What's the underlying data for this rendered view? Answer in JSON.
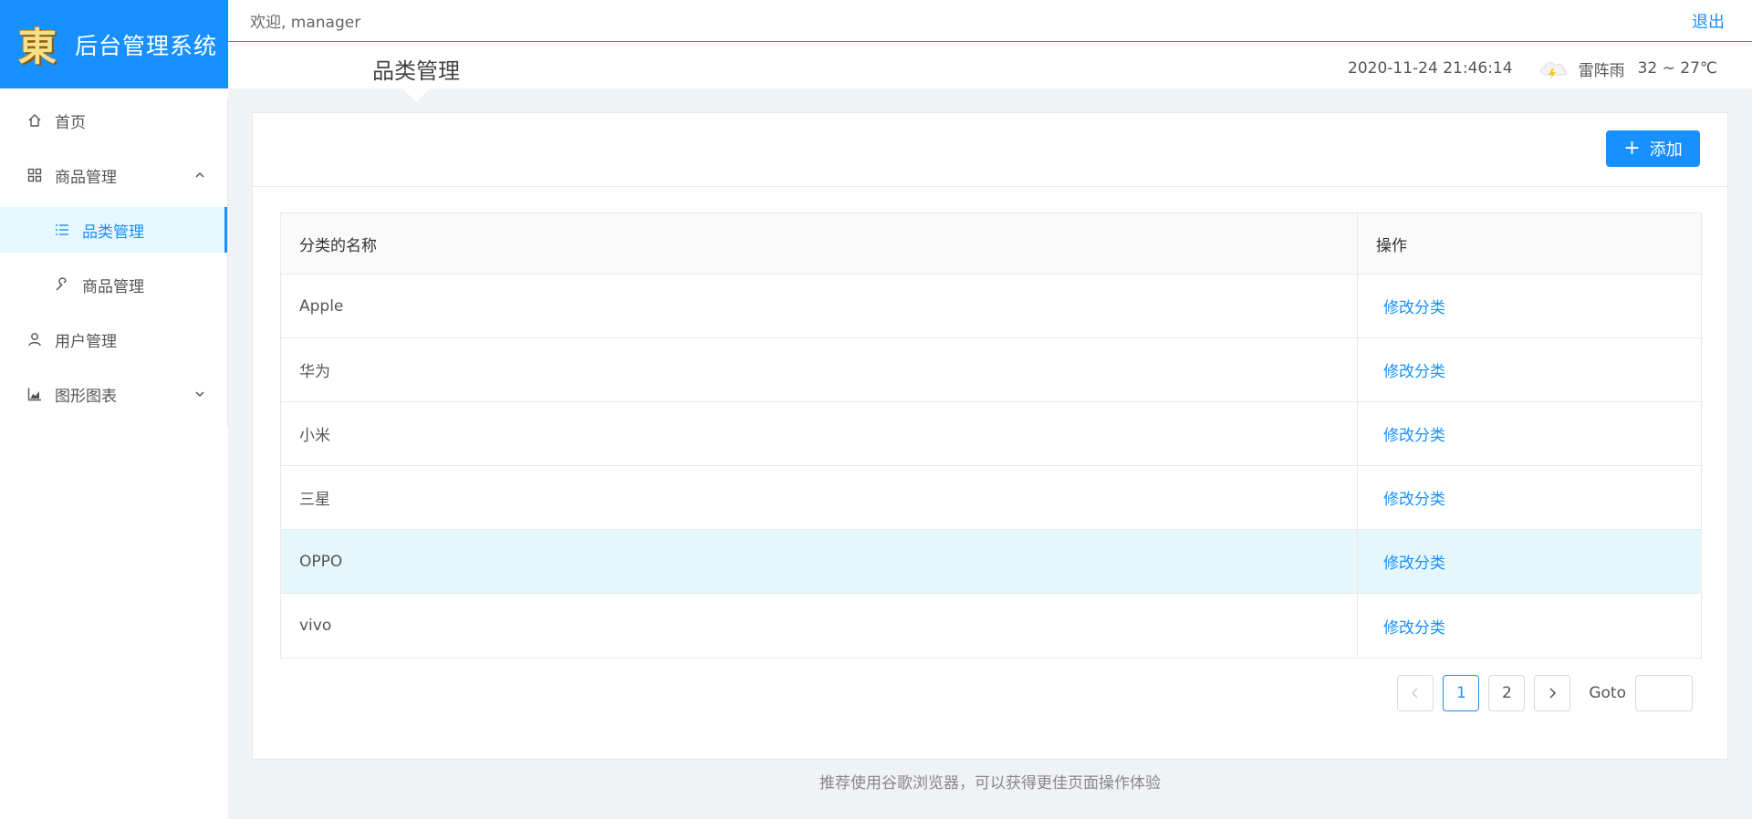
{
  "app": {
    "logo_char": "東",
    "title": "后台管理系统"
  },
  "sidebar": {
    "items": [
      {
        "label": "首页",
        "icon": "home-icon"
      },
      {
        "label": "商品管理",
        "icon": "appstore-icon"
      },
      {
        "label": "品类管理",
        "icon": "bars-icon"
      },
      {
        "label": "商品管理",
        "icon": "tool-icon"
      },
      {
        "label": "用户管理",
        "icon": "user-icon"
      },
      {
        "label": "图形图表",
        "icon": "area-chart-icon"
      }
    ]
  },
  "header": {
    "welcome": "欢迎, manager",
    "logout": "退出",
    "page_title": "品类管理",
    "datetime": "2020-11-24 21:46:14",
    "weather": "雷阵雨",
    "temperature": "32 ~ 27℃"
  },
  "card": {
    "add_label": "添加"
  },
  "table": {
    "columns": [
      "分类的名称",
      "操作"
    ],
    "rows": [
      {
        "name": "Apple",
        "action": "修改分类"
      },
      {
        "name": "华为",
        "action": "修改分类"
      },
      {
        "name": "小米",
        "action": "修改分类"
      },
      {
        "name": "三星",
        "action": "修改分类"
      },
      {
        "name": "OPPO",
        "action": "修改分类"
      },
      {
        "name": "vivo",
        "action": "修改分类"
      }
    ]
  },
  "pagination": {
    "pages": [
      "1",
      "2"
    ],
    "current": "1",
    "goto_label": "Goto"
  },
  "footer": "推荐使用谷歌浏览器，可以获得更佳页面操作体验",
  "colors": {
    "primary": "#1890ff",
    "highlight_row": "#e6f7fc"
  }
}
